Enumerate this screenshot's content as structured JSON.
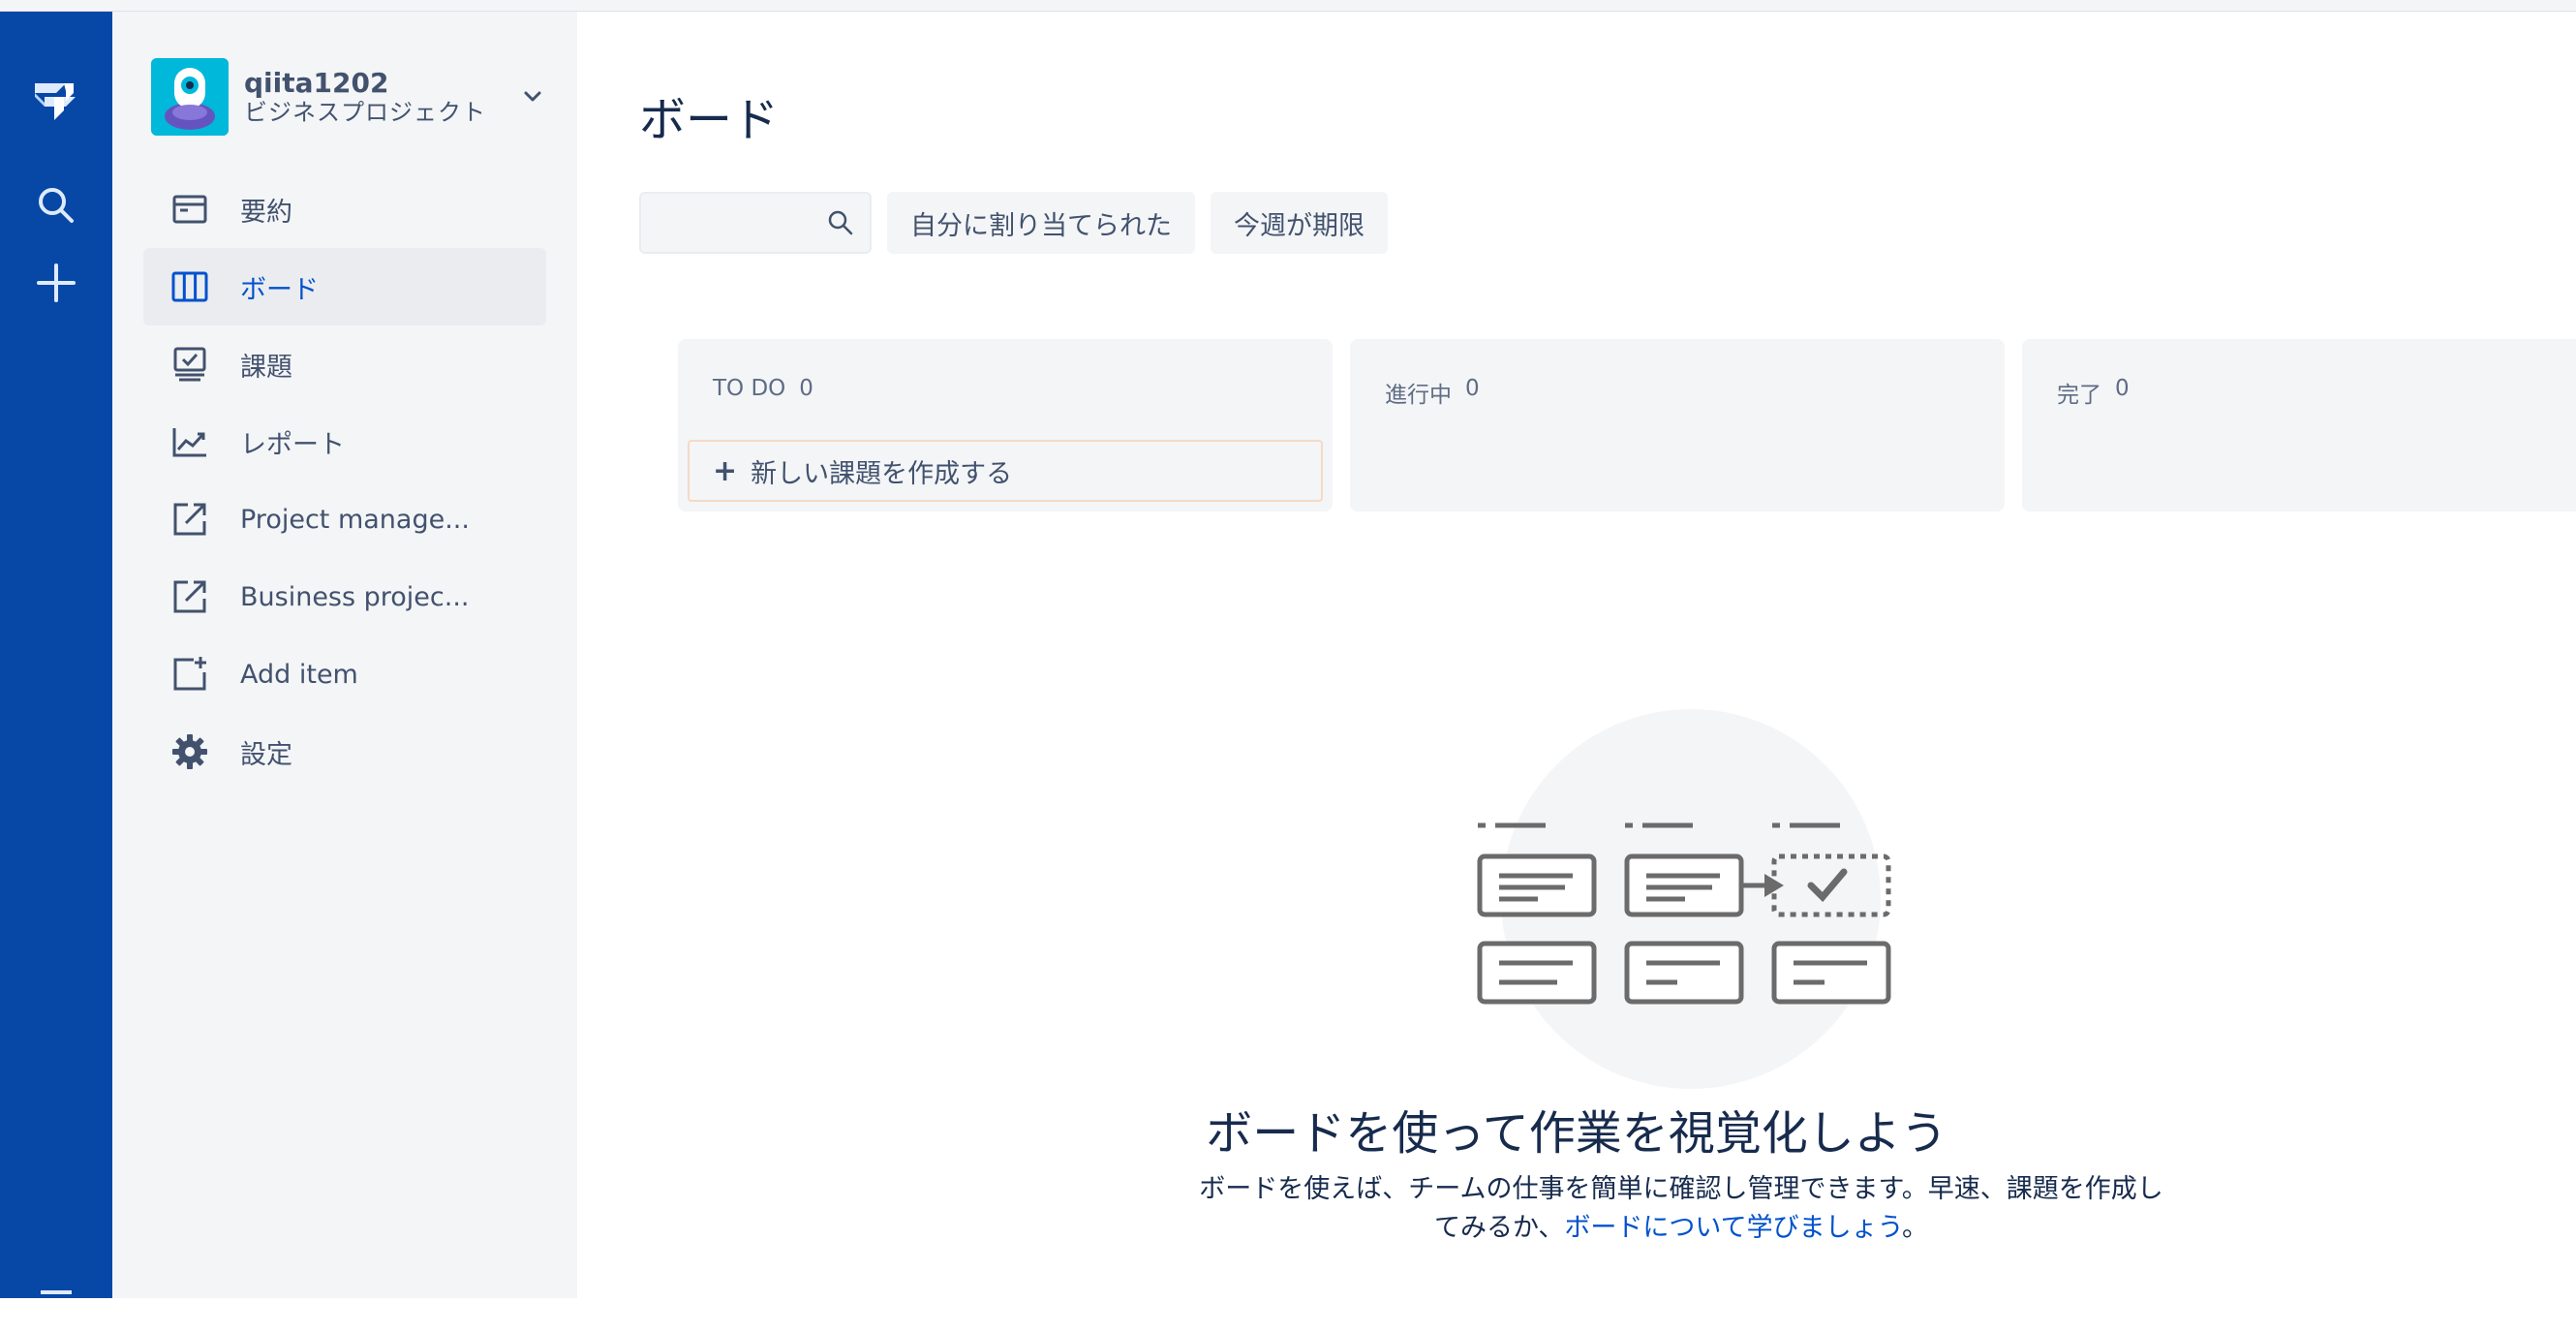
{
  "global_nav": {
    "icons": [
      "jira-logo-icon",
      "search-icon",
      "plus-icon",
      "menu-icon"
    ],
    "background": "#0747a6"
  },
  "project": {
    "name": "qiita1202",
    "type": "ビジネスプロジェクト"
  },
  "sidebar": {
    "items": [
      {
        "label": "要約",
        "icon": "summary-icon",
        "active": false
      },
      {
        "label": "ボード",
        "icon": "board-icon",
        "active": true
      },
      {
        "label": "課題",
        "icon": "issues-icon",
        "active": false
      },
      {
        "label": "レポート",
        "icon": "reports-icon",
        "active": false
      },
      {
        "label": "Project manage...",
        "icon": "external-link-icon",
        "active": false
      },
      {
        "label": "Business projec...",
        "icon": "external-link-icon",
        "active": false
      },
      {
        "label": "Add item",
        "icon": "add-page-icon",
        "active": false
      },
      {
        "label": "設定",
        "icon": "gear-icon",
        "active": false
      }
    ]
  },
  "main": {
    "title": "ボード",
    "search_placeholder": "",
    "filters": [
      "自分に割り当てられた",
      "今週が期限"
    ],
    "columns": [
      {
        "name": "TO DO",
        "count": "0"
      },
      {
        "name": "進行中",
        "count": "0"
      },
      {
        "name": "完了",
        "count": "0"
      }
    ],
    "create_issue_label": "新しい課題を作成する",
    "empty_state": {
      "title": "ボードを使って作業を視覚化しよう",
      "desc_text": "ボードを使えば、チームの仕事を簡単に確認し管理できます。早速、課題を作成してみるか、",
      "desc_link": "ボードについて学びましょう",
      "desc_end": "。"
    }
  },
  "colors": {
    "accent": "#0052cc",
    "sidebar_bg": "#f4f5f7",
    "text": "#172b4d"
  }
}
